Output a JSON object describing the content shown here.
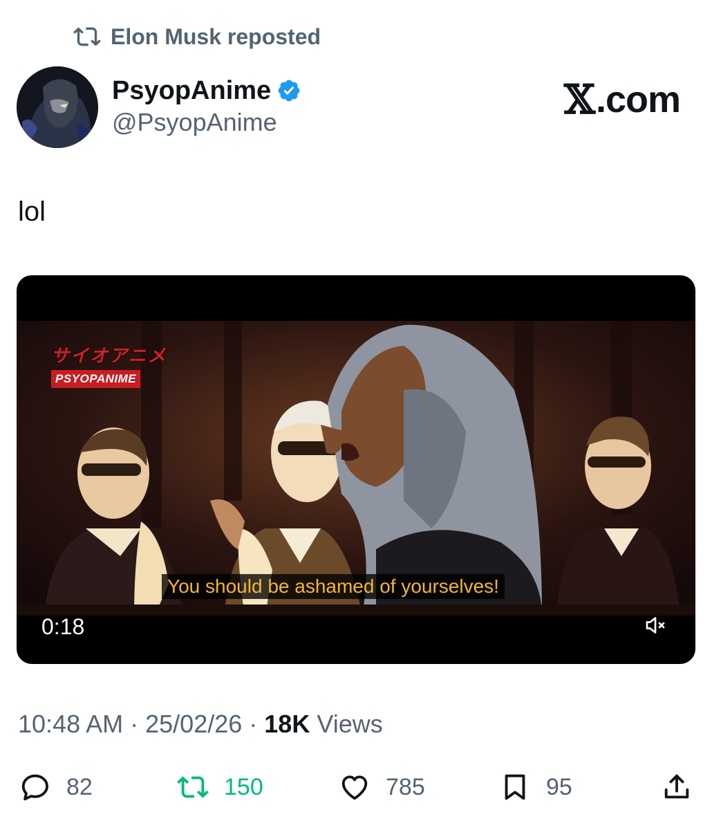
{
  "repost": {
    "text": "Elon Musk reposted"
  },
  "author": {
    "name": "PsyopAnime",
    "handle": "@PsyopAnime"
  },
  "brand_logo": "X.com",
  "tweet": {
    "text": "lol"
  },
  "video": {
    "overlay_logo_kana": "サイオアニメ",
    "overlay_logo_label": "PSYOPANIME",
    "subtitle": "You should be ashamed of yourselves!",
    "duration": "0:18",
    "muted": true
  },
  "meta": {
    "time": "10:48 AM",
    "date": "25/02/26",
    "views_count": "18K",
    "views_label": "Views"
  },
  "actions": {
    "replies": "82",
    "reposts": "150",
    "likes": "785",
    "bookmarks": "95"
  },
  "colors": {
    "secondary_text": "#536471",
    "repost_active": "#00ba7c",
    "verified": "#1d9bf0",
    "subtitle": "#f3b62e",
    "brand_red": "#c81d22"
  }
}
